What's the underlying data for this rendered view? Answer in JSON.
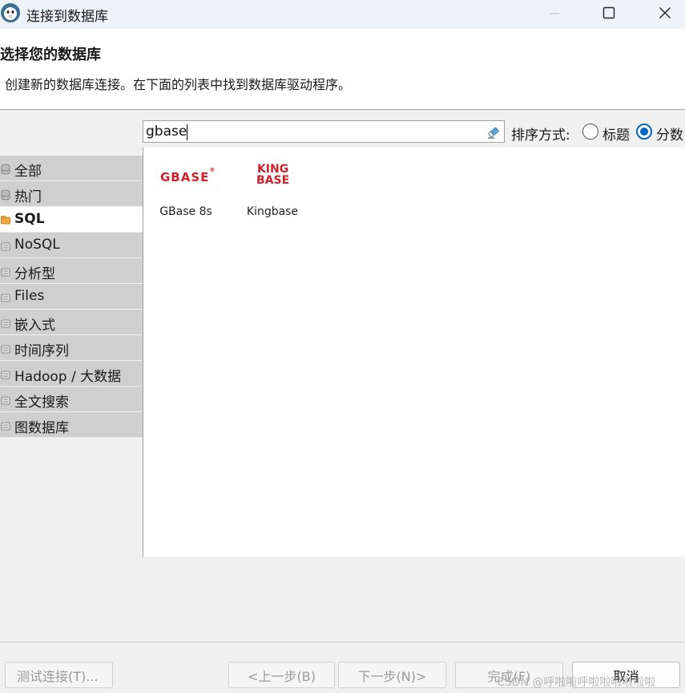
{
  "window": {
    "title": "连接到数据库"
  },
  "header": {
    "title": "选择您的数据库",
    "description": "创建新的数据库连接。在下面的列表中找到数据库驱动程序。"
  },
  "search": {
    "value": "gbase"
  },
  "sort": {
    "label": "排序方式:",
    "options": [
      {
        "label": "标题",
        "selected": false
      },
      {
        "label": "分数",
        "selected": true
      }
    ]
  },
  "categories": [
    {
      "label": "全部",
      "selected": false
    },
    {
      "label": "热门",
      "selected": false
    },
    {
      "label": "SQL",
      "selected": true
    },
    {
      "label": "NoSQL",
      "selected": false
    },
    {
      "label": "分析型",
      "selected": false
    },
    {
      "label": "Files",
      "selected": false
    },
    {
      "label": "嵌入式",
      "selected": false
    },
    {
      "label": "时间序列",
      "selected": false
    },
    {
      "label": "Hadoop / 大数据",
      "selected": false
    },
    {
      "label": "全文搜索",
      "selected": false
    },
    {
      "label": "图数据库",
      "selected": false
    }
  ],
  "drivers": [
    {
      "name": "GBase 8s",
      "logo_text": "GBASE",
      "logo_mark": "®",
      "logo_color": "#d0202a"
    },
    {
      "name": "Kingbase",
      "logo_line1": "KING",
      "logo_line2": "BASE",
      "logo_color": "#d0202a"
    }
  ],
  "buttons": {
    "test": "测试连接(T)...",
    "prev": "<上一步(B)",
    "next": "下一步(N)>",
    "finish": "完成(F)",
    "cancel": "取消"
  },
  "watermark": "CSDN @呼啦啦呼啦啦啦啦啦啦"
}
